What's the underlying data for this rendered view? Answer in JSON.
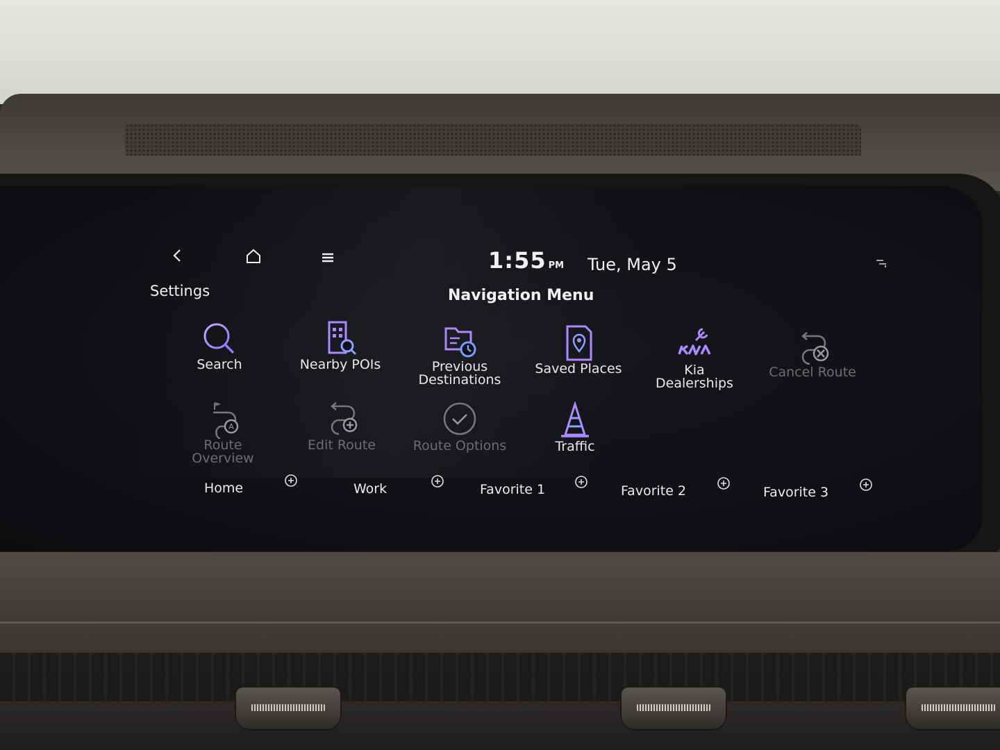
{
  "status_bar": {
    "time": "1:55",
    "ampm": "PM",
    "date": "Tue, May 5"
  },
  "header": {
    "settings_label": "Settings",
    "title": "Navigation Menu"
  },
  "menu": {
    "items": [
      {
        "label": "Search",
        "icon": "search-icon",
        "enabled": true
      },
      {
        "label": "Nearby POIs",
        "icon": "nearby-pois-icon",
        "enabled": true
      },
      {
        "label": "Previous\nDestinations",
        "icon": "previous-destinations-icon",
        "enabled": true
      },
      {
        "label": "Saved Places",
        "icon": "saved-places-icon",
        "enabled": true
      },
      {
        "label": "Kia\nDealerships",
        "icon": "kia-dealerships-icon",
        "enabled": true
      },
      {
        "label": "Cancel Route",
        "icon": "cancel-route-icon",
        "enabled": false
      },
      {
        "label": "Route\nOverview",
        "icon": "route-overview-icon",
        "enabled": false
      },
      {
        "label": "Edit Route",
        "icon": "edit-route-icon",
        "enabled": false
      },
      {
        "label": "Route Options",
        "icon": "route-options-icon",
        "enabled": false
      },
      {
        "label": "Traffic",
        "icon": "traffic-cone-icon",
        "enabled": true
      }
    ]
  },
  "favorites": [
    {
      "label": "Home"
    },
    {
      "label": "Work"
    },
    {
      "label": "Favorite 1"
    },
    {
      "label": "Favorite 2"
    },
    {
      "label": "Favorite 3"
    }
  ],
  "colors": {
    "accent_purple": "#a98bff",
    "accent_blue": "#7f9bff",
    "disabled_gray": "#6c6c72",
    "text": "#f1f1f4",
    "screen_bg": "#101116"
  }
}
